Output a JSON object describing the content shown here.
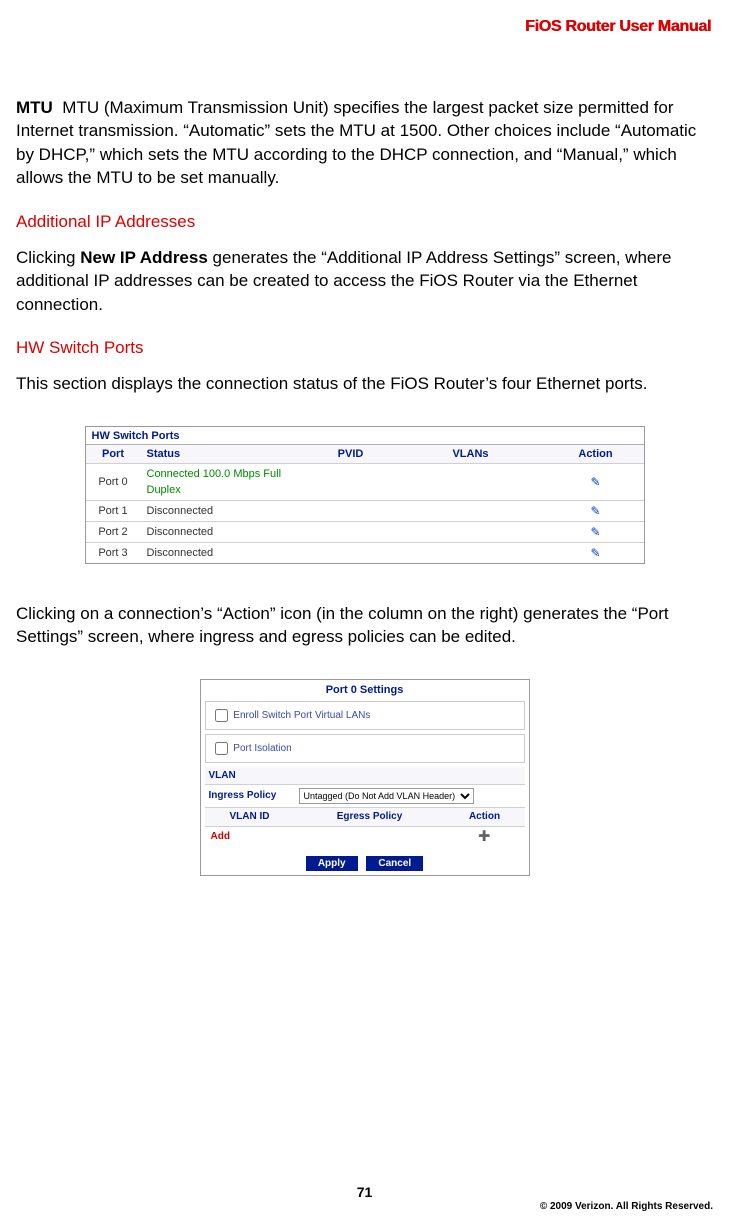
{
  "header": {
    "title": "FiOS Router User Manual"
  },
  "mtu": {
    "term": "MTU",
    "text": "MTU (Maximum Transmission Unit) specifies the largest packet size permitted for Internet transmission. “Automatic” sets the MTU at 1500. Other choices include “Automatic by DHCP,” which sets the MTU according to the DHCP connection, and “Manual,” which allows the MTU to be set manually."
  },
  "additional_ip": {
    "heading": "Additional IP Addresses",
    "pre": "Clicking ",
    "bold": "New IP Address",
    "post": " generates the “Additional IP Address Settings” screen, where additional IP addresses can be created to access the FiOS Router via the Ethernet connection."
  },
  "hw_switch": {
    "heading": "HW Switch Ports",
    "intro": "This section displays the connection status of the FiOS Router’s four Ethernet ports.",
    "panel_title": "HW Switch Ports",
    "columns": {
      "port": "Port",
      "status": "Status",
      "pvid": "PVID",
      "vlans": "VLANs",
      "action": "Action"
    },
    "rows": [
      {
        "port": "Port 0",
        "status": "Connected 100.0 Mbps Full Duplex",
        "connected": true
      },
      {
        "port": "Port 1",
        "status": "Disconnected",
        "connected": false
      },
      {
        "port": "Port 2",
        "status": "Disconnected",
        "connected": false
      },
      {
        "port": "Port 3",
        "status": "Disconnected",
        "connected": false
      }
    ],
    "after": "Clicking on a connection’s “Action” icon (in the column on the right) generates the “Port Settings” screen, where ingress and egress policies can be edited."
  },
  "port_settings": {
    "title": "Port 0 Settings",
    "enroll": "Enroll Switch Port Virtual LANs",
    "isolation": "Port Isolation",
    "vlan_label": "VLAN",
    "ingress_label": "Ingress Policy",
    "ingress_selected": "Untagged (Do Not Add VLAN Header)",
    "cols": {
      "vlan_id": "VLAN ID",
      "egress": "Egress Policy",
      "action": "Action"
    },
    "add_label": "Add",
    "apply": "Apply",
    "cancel": "Cancel"
  },
  "footer": {
    "page": "71",
    "copyright": "© 2009 Verizon. All Rights Reserved."
  }
}
